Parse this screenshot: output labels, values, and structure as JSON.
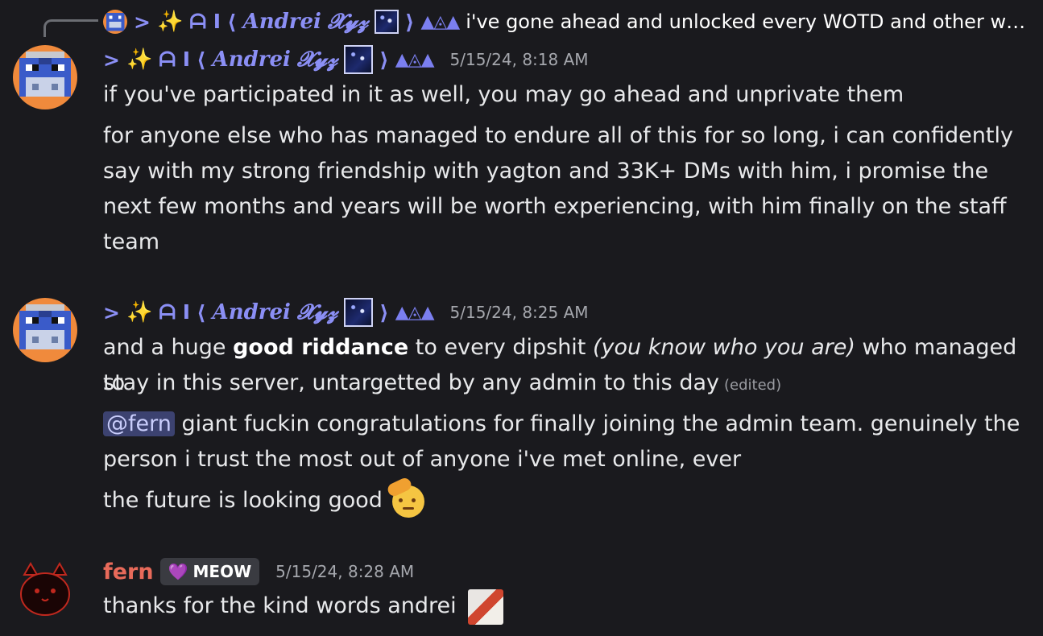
{
  "reply": {
    "prefix": ">",
    "sparkle": "✨",
    "name_a": "ᗩ I",
    "bracket_open": "⟨",
    "name_main": "Andrei",
    "name_script": "𝓧𝔂𝔃",
    "bracket_close": "⟩",
    "triangles": "▲◬▲",
    "text": "i've gone ahead and unlocked every WOTD and other wo..."
  },
  "messages": [
    {
      "author": {
        "prefix": ">",
        "sparkle": "✨",
        "name_a": "ᗩ I",
        "bracket_open": "⟨",
        "name_main": "Andrei",
        "name_script": "𝓧𝔂𝔃",
        "bracket_close": "⟩",
        "triangles": "▲◬▲"
      },
      "timestamp": "5/15/24, 8:18 AM",
      "lines": [
        "if you've participated in it as well, you may go ahead and unprivate them",
        "for anyone else who has managed to endure all of this for so long, i can confidently",
        "say with my strong friendship with yagton and 33K+ DMs with him, i promise the",
        "next few months and years will be worth experiencing, with him finally on the staff",
        "team"
      ]
    },
    {
      "author": {
        "prefix": ">",
        "sparkle": "✨",
        "name_a": "ᗩ I",
        "bracket_open": "⟨",
        "name_main": "Andrei",
        "name_script": "𝓧𝔂𝔃",
        "bracket_close": "⟩",
        "triangles": "▲◬▲"
      },
      "timestamp": "5/15/24, 8:25 AM",
      "line1_a": "and a huge ",
      "line1_bold": "good riddance",
      "line1_b": " to every dipshit ",
      "line1_italic": "(you know who you are)",
      "line1_c": " who managed to",
      "line2": "stay in this server, untargetted by any admin to this day",
      "edited": "(edited)",
      "mention": "@fern",
      "line3": " giant fuckin congratulations for finally joining the admin team. genuinely the",
      "line4": "person i trust the most out of anyone i've met online, ever",
      "line5": "the future is looking good",
      "emoji": "saluting-face"
    },
    {
      "author": "fern",
      "role_heart": "💜",
      "role": "MEOW",
      "timestamp": "5/15/24, 8:28 AM",
      "text": "thanks for the kind words andrei"
    }
  ],
  "colors": {
    "background": "#1a1a1e",
    "username_andrei": "#8b8ff5",
    "username_fern": "#e86a5a",
    "mention_bg": "#3c4270",
    "timestamp": "#a5a7ad"
  }
}
